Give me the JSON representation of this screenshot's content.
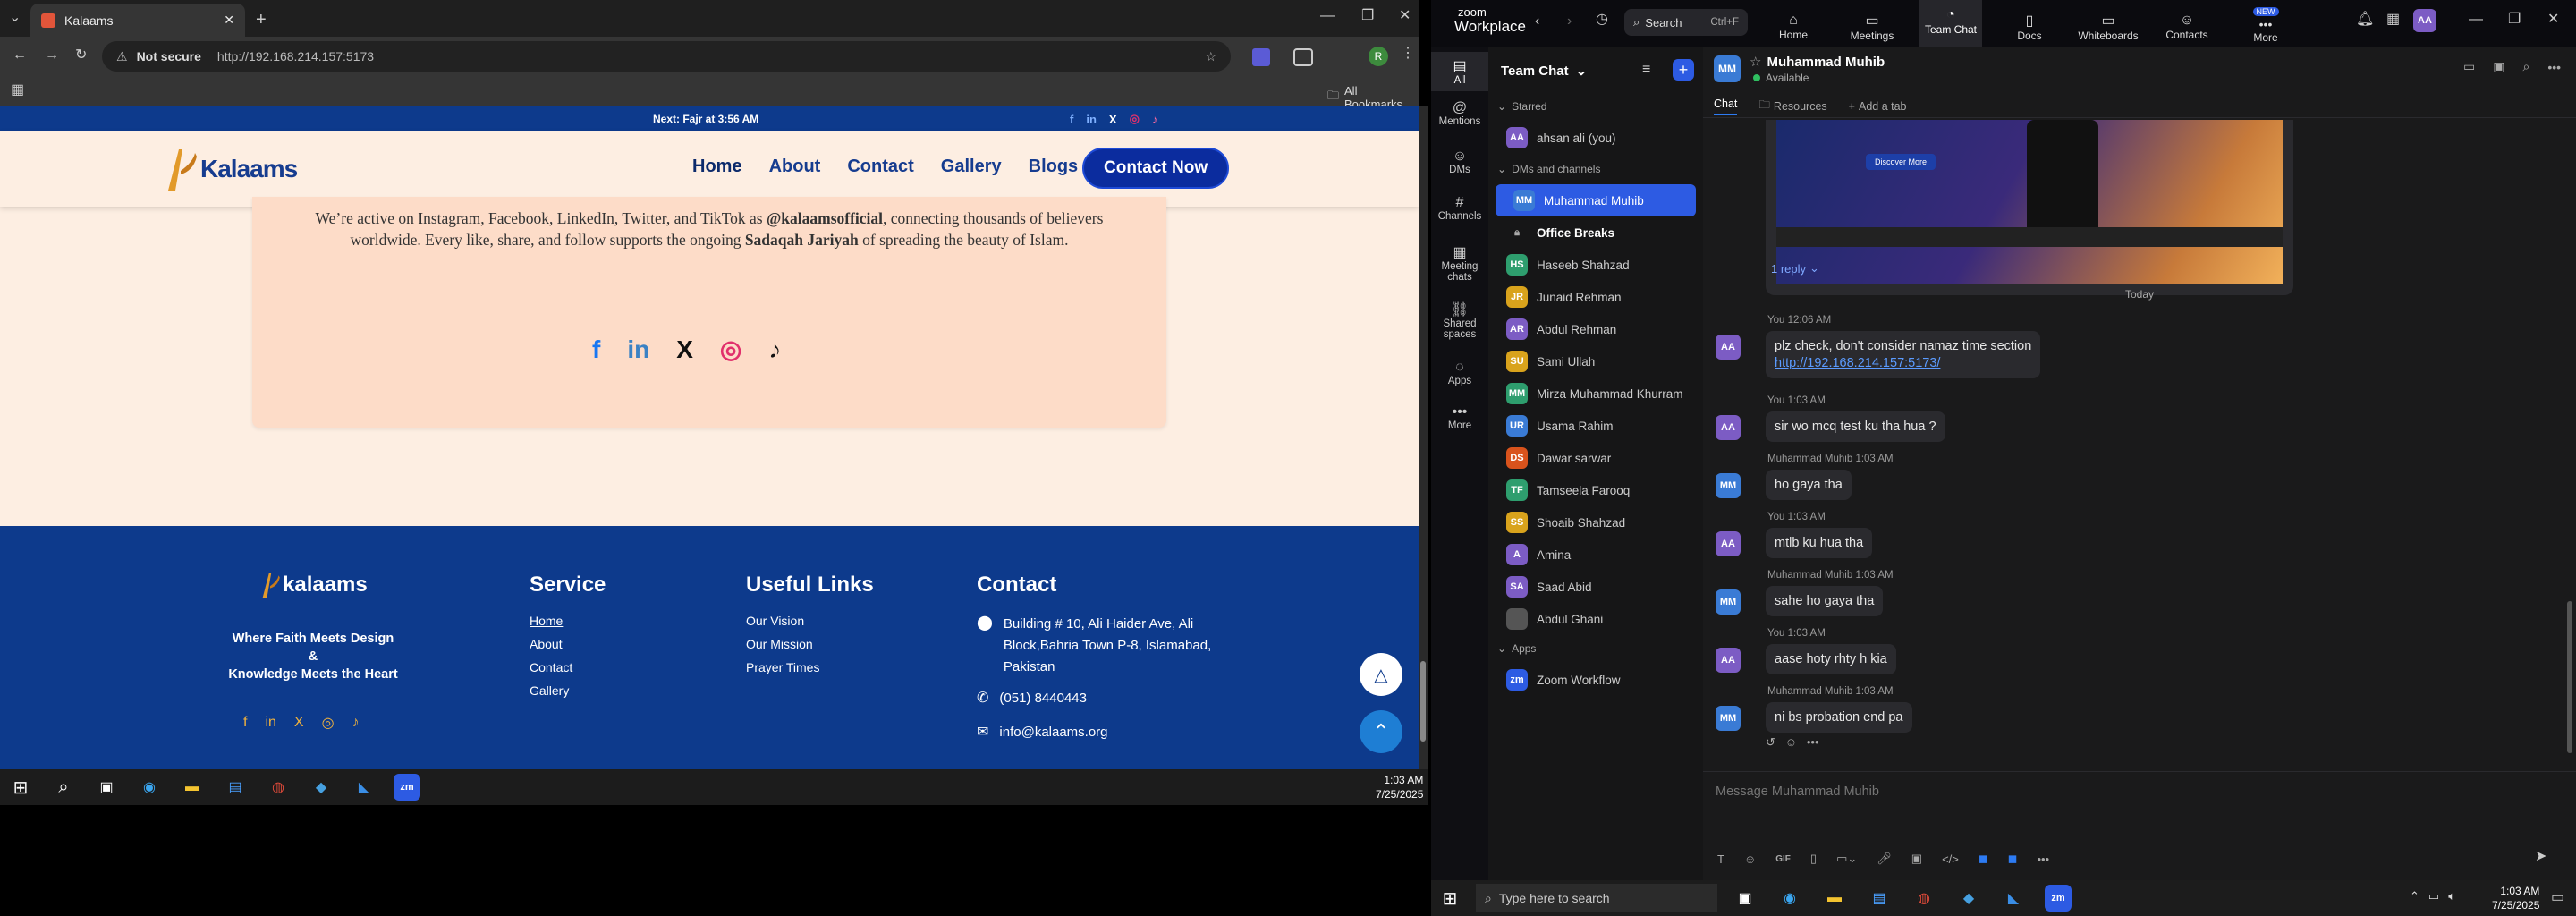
{
  "browser": {
    "tab_title": "Kalaams",
    "security": "Not secure",
    "url": "http://192.168.214.157:5173",
    "bookmarks_label": "All Bookmarks",
    "profile_letter": "R"
  },
  "site": {
    "topbar_text": "Next: Fajr at 3:56 AM",
    "logo_text": "Kalaams",
    "nav": [
      "Home",
      "About",
      "Contact",
      "Gallery",
      "Blogs"
    ],
    "cta": "Contact Now",
    "social_p1": "We’re active on Instagram, Facebook, LinkedIn, Twitter, and TikTok as ",
    "social_handle": "@kalaamsofficial",
    "social_p2": ", connecting thousands of believers worldwide. Every like, share, and follow supports the ongoing ",
    "social_bold2": "Sadaqah Jariyah",
    "social_p3": " of spreading the beauty of Islam.",
    "footer": {
      "logo_text": "kalaams",
      "tagline1": "Where Faith Meets Design",
      "tagline_amp": "&",
      "tagline2": "Knowledge Meets the Heart",
      "service_title": "Service",
      "service": [
        "Home",
        "About",
        "Contact",
        "Gallery"
      ],
      "links_title": "Useful Links",
      "links": [
        "Our Vision",
        "Our Mission",
        "Prayer Times"
      ],
      "contact_title": "Contact",
      "address": "Building # 10, Ali Haider Ave, Ali Block,Bahria Town P-8, Islamabad, Pakistan",
      "phone": "(051) 8440443",
      "email": "info@kalaams.org"
    }
  },
  "taskbar_left": {
    "time": "1:03 AM",
    "date": "7/25/2025"
  },
  "zoom": {
    "brand_top": "zoom",
    "brand_bottom": "Workplace",
    "search": "Search",
    "search_shortcut": "Ctrl+F",
    "tabs": [
      {
        "label": "Home"
      },
      {
        "label": "Meetings"
      },
      {
        "label": "Team Chat"
      },
      {
        "label": "Docs"
      },
      {
        "label": "Whiteboards"
      },
      {
        "label": "Contacts"
      },
      {
        "label": "More",
        "badge": "NEW"
      }
    ],
    "user_initials": "AA",
    "sidebar": [
      "All",
      "Mentions",
      "DMs",
      "Channels",
      "Meeting chats",
      "Shared spaces",
      "Apps",
      "More"
    ],
    "list_title": "Team Chat",
    "starred_header": "Starred",
    "starred": [
      {
        "name": "ahsan ali (you)",
        "initials": "AA",
        "color": "#7c5cc4"
      }
    ],
    "dms_header": "DMs and channels",
    "dms": [
      {
        "name": "Muhammad Muhib",
        "initials": "MM",
        "color": "#3a7bd5",
        "selected": true
      },
      {
        "name": "Office Breaks",
        "initials": "",
        "color": "",
        "bold": true
      },
      {
        "name": "Haseeb Shahzad",
        "initials": "HS",
        "color": "#2e9e6e"
      },
      {
        "name": "Junaid Rehman",
        "initials": "JR",
        "color": "#d9a31c"
      },
      {
        "name": "Abdul Rehman",
        "initials": "AR",
        "color": "#7c5cc4"
      },
      {
        "name": "Sami Ullah",
        "initials": "SU",
        "color": "#d9a31c"
      },
      {
        "name": "Mirza Muhammad Khurram",
        "initials": "MM",
        "color": "#2e9e6e"
      },
      {
        "name": "Usama Rahim",
        "initials": "UR",
        "color": "#3a7bd5"
      },
      {
        "name": "Dawar sarwar",
        "initials": "DS",
        "color": "#d9531c"
      },
      {
        "name": "Tamseela Farooq",
        "initials": "TF",
        "color": "#2e9e6e"
      },
      {
        "name": "Shoaib Shahzad",
        "initials": "SS",
        "color": "#d9a31c"
      },
      {
        "name": "Amina",
        "initials": "A",
        "color": "#7c5cc4"
      },
      {
        "name": "Saad Abid",
        "initials": "SA",
        "color": "#7c5cc4"
      },
      {
        "name": "Abdul Ghani",
        "initials": "",
        "color": "#888"
      }
    ],
    "apps_header": "Apps",
    "apps": [
      {
        "name": "Zoom Workflow",
        "initials": "zm",
        "color": "#2d5be3"
      }
    ],
    "chat": {
      "contact": "Muhammad Muhib",
      "initials": "MM",
      "status": "Available",
      "tabs": [
        "Chat",
        "Resources",
        "Add a tab"
      ],
      "replies": "1 reply",
      "day": "Today",
      "messages": [
        {
          "who": "You",
          "time": "12:06 AM",
          "initials": "AA",
          "color": "#7c5cc4",
          "text": "plz check, don't consider namaz time section",
          "link": "http://192.168.214.157:5173/"
        },
        {
          "who": "You",
          "time": "1:03 AM",
          "initials": "AA",
          "color": "#7c5cc4",
          "text": "sir wo mcq test ku tha hua ?"
        },
        {
          "who": "Muhammad Muhib",
          "time": "1:03 AM",
          "initials": "MM",
          "color": "#3a7bd5",
          "text": "ho gaya tha"
        },
        {
          "who": "You",
          "time": "1:03 AM",
          "initials": "AA",
          "color": "#7c5cc4",
          "text": "mtlb ku hua tha"
        },
        {
          "who": "Muhammad Muhib",
          "time": "1:03 AM",
          "initials": "MM",
          "color": "#3a7bd5",
          "text": "sahe ho gaya tha"
        },
        {
          "who": "You",
          "time": "1:03 AM",
          "initials": "AA",
          "color": "#7c5cc4",
          "text": "aase hoty rhty h kia"
        },
        {
          "who": "Muhammad Muhib",
          "time": "1:03 AM",
          "initials": "MM",
          "color": "#3a7bd5",
          "text": "ni bs probation end pa"
        }
      ],
      "image_button": "Discover More",
      "compose_placeholder": "Message Muhammad Muhib",
      "gif": "GIF"
    }
  },
  "taskbar_right": {
    "search_placeholder": "Type here to search",
    "time": "1:03 AM",
    "date": "7/25/2025"
  }
}
